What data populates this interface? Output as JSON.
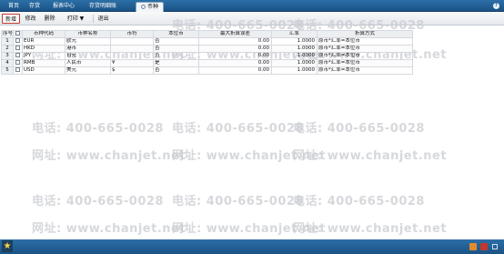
{
  "tabs": [
    {
      "label": "首页",
      "active": false
    },
    {
      "label": "存货",
      "active": false
    },
    {
      "label": "报表中心",
      "active": false
    },
    {
      "label": "存货明细账",
      "active": false
    },
    {
      "label": "币种",
      "active": true
    }
  ],
  "toolbar": {
    "new_label": "新增",
    "edit_label": "修改",
    "delete_label": "删除",
    "print_label": "打印 ▼",
    "exit_label": "退出"
  },
  "help": {
    "label": "?"
  },
  "grid": {
    "headers": {
      "rowno": "序号",
      "code": "币种代码",
      "name": "币种名称",
      "symbol": "币符",
      "is_base": "本位币",
      "max_error": "最大折算误差",
      "rate": "汇率",
      "method": "折算方式"
    },
    "rows": [
      {
        "no": "1",
        "code": "EUR",
        "name": "欧元",
        "symbol": "",
        "is_base": "否",
        "max_error": "0.00",
        "rate": "1.0000",
        "method": "原币*汇率=本位币"
      },
      {
        "no": "2",
        "code": "HKD",
        "name": "港币",
        "symbol": "",
        "is_base": "否",
        "max_error": "0.00",
        "rate": "1.0000",
        "method": "原币*汇率=本位币"
      },
      {
        "no": "3",
        "code": "JPY",
        "name": "日元",
        "symbol": "",
        "is_base": "否",
        "max_error": "0.00",
        "rate": "1.0000",
        "method": "原币*汇率=本位币"
      },
      {
        "no": "4",
        "code": "RMB",
        "name": "人民币",
        "symbol": "¥",
        "is_base": "是",
        "max_error": "0.00",
        "rate": "1.0000",
        "method": "原币*汇率=本位币"
      },
      {
        "no": "5",
        "code": "USD",
        "name": "美元",
        "symbol": "$",
        "is_base": "否",
        "max_error": "0.00",
        "rate": "1.0000",
        "method": "原币*汇率=本位币"
      }
    ]
  },
  "watermark": {
    "phone": "电话: 400-665-0028",
    "site": "网址: www.chanjet.net"
  },
  "colors": {
    "tab_bar": "#2c6fa7",
    "active_button_border": "#c0392b"
  },
  "icons": [
    "help-icon",
    "star-icon",
    "tray-icons"
  ]
}
